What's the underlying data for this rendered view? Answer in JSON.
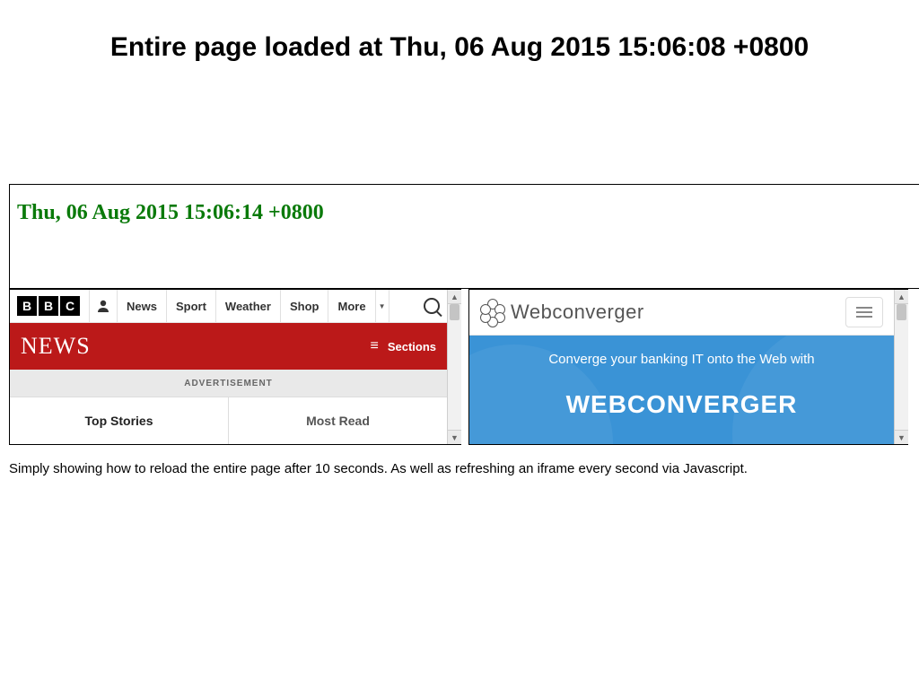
{
  "page_title": "Entire page loaded at Thu, 06 Aug 2015 15:06:08 +0800",
  "timestamp": "Thu, 06 Aug 2015 15:06:14 +0800",
  "bbc": {
    "logo_letters": [
      "B",
      "B",
      "C"
    ],
    "nav": {
      "news": "News",
      "sport": "Sport",
      "weather": "Weather",
      "shop": "Shop",
      "more": "More"
    },
    "red_title": "NEWS",
    "sections_label": "Sections",
    "ad_label": "ADVERTISEMENT",
    "tabs": {
      "top": "Top Stories",
      "most": "Most Read"
    }
  },
  "wc": {
    "brand": "Webconverger",
    "subtext": "Converge your banking IT onto the Web with",
    "big": "WEBCONVERGER"
  },
  "description": "Simply showing how to reload the entire page after 10 seconds. As well as refreshing an iframe every second via Javascript."
}
